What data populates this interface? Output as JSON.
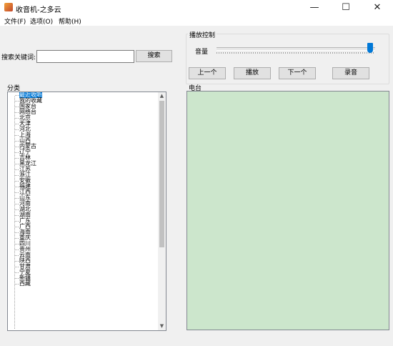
{
  "window": {
    "title": "收音机-之多云"
  },
  "menu": [
    {
      "label": "文件(F)"
    },
    {
      "label": "选项(O)"
    },
    {
      "label": "帮助(H)"
    }
  ],
  "search": {
    "label": "搜索关键词:",
    "value": "",
    "button": "搜索"
  },
  "playback": {
    "title": "播放控制",
    "volume_label": "音量",
    "volume_level": 0.97,
    "buttons": {
      "prev": "上一个",
      "play": "播放",
      "next": "下一个",
      "record": "录音"
    }
  },
  "categories": {
    "label": "分类",
    "items": [
      "最近收听",
      "我的收藏",
      "国家台",
      "网络台",
      "北京",
      "天津",
      "河北",
      "上海",
      "山西",
      "内蒙古",
      "辽宁",
      "吉林",
      "黑龙江",
      "江苏",
      "浙江",
      "安徽",
      "福建",
      "江西",
      "山东",
      "河南",
      "湖北",
      "湖南",
      "广东",
      "广西",
      "海南",
      "重庆",
      "四川",
      "贵州",
      "云南",
      "陕西",
      "甘肃",
      "宁夏",
      "新疆",
      "西藏"
    ],
    "selected": "最近收听"
  },
  "stations": {
    "label": "电台"
  },
  "colors": {
    "accent": "#0078d7",
    "station_panel": "#cce6cc"
  }
}
